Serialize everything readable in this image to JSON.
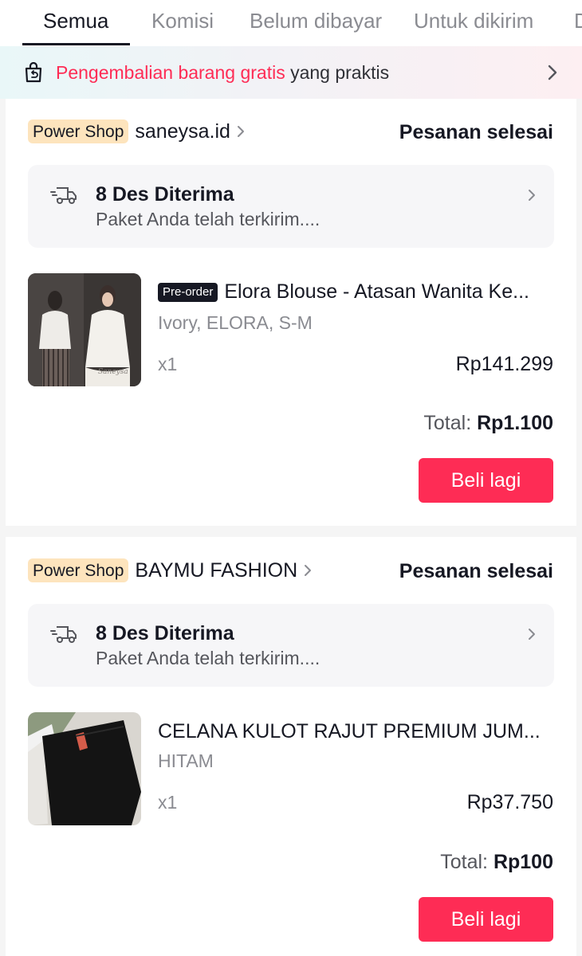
{
  "tabs": [
    {
      "label": "Semua",
      "active": true
    },
    {
      "label": "Komisi",
      "active": false
    },
    {
      "label": "Belum dibayar",
      "active": false
    },
    {
      "label": "Untuk dikirim",
      "active": false
    },
    {
      "label": "D",
      "active": false
    }
  ],
  "banner": {
    "highlight": "Pengembalian barang gratis",
    "rest": " yang praktis",
    "icon": "return-bag-icon"
  },
  "orders": [
    {
      "badge": "Power Shop",
      "shop": "saneysa.id",
      "status": "Pesanan selesai",
      "delivery_title": "8 Des Diterima",
      "delivery_sub": "Paket Anda telah terkirim....",
      "preorder": "Pre-order",
      "product_title": "Elora Blouse - Atasan Wanita Ke...",
      "variant": "Ivory, ELORA, S-M",
      "qty": "x1",
      "price": "Rp141.299",
      "total_label": "Total: ",
      "total_value": "Rp1.100",
      "button": "Beli lagi"
    },
    {
      "badge": "Power Shop",
      "shop": "BAYMU FASHION",
      "status": "Pesanan selesai",
      "delivery_title": "8 Des Diterima",
      "delivery_sub": "Paket Anda telah terkirim....",
      "product_title": "CELANA KULOT RAJUT PREMIUM JUM...",
      "variant": "HITAM",
      "qty": "x1",
      "price": "Rp37.750",
      "total_label": "Total: ",
      "total_value": "Rp100",
      "button": "Beli lagi"
    }
  ],
  "colors": {
    "accent": "#fe2c55",
    "badge_bg": "#fde4bd",
    "text": "#161823"
  }
}
